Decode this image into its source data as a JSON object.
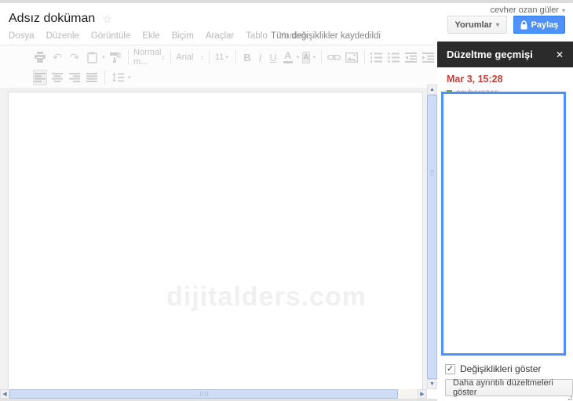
{
  "header": {
    "account_name": "cevher ozan güler",
    "title": "Adsız doküman",
    "menu": [
      "Dosya",
      "Düzenle",
      "Görüntüle",
      "Ekle",
      "Biçim",
      "Araçlar",
      "Tablo",
      "Yardım"
    ],
    "save_status": "Tüm değişiklikler kaydedildi",
    "comments_button": "Yorumlar",
    "share_button": "Paylaş"
  },
  "toolbar": {
    "style": "Normal m...",
    "font": "Arial",
    "size": "11",
    "bold": "B",
    "italic": "I",
    "underline": "U",
    "text_color": "A",
    "highlight": "A"
  },
  "revision_panel": {
    "title": "Düzeltme geçmişi",
    "date": "Mar 3, 15:28",
    "author": "cevherozan",
    "show_changes": "Değişiklikleri göster",
    "show_detail_button": "Daha ayrıntılı düzeltmeleri göster"
  },
  "document": {
    "watermark": "dijitalders.com"
  },
  "icons": {
    "star": "☆",
    "dropdown": "▾",
    "updown": "↕",
    "close": "✕",
    "check": "✓",
    "undo": "↶",
    "redo": "↷",
    "arrow_up": "▲",
    "arrow_down": "▼",
    "arrow_left": "◀",
    "arrow_right": "▶"
  },
  "colors": {
    "accent_blue": "#4d90fe",
    "revision_red": "#bf4136",
    "author_green": "#63b04a",
    "panel_header_bg": "#2b2b2b"
  }
}
